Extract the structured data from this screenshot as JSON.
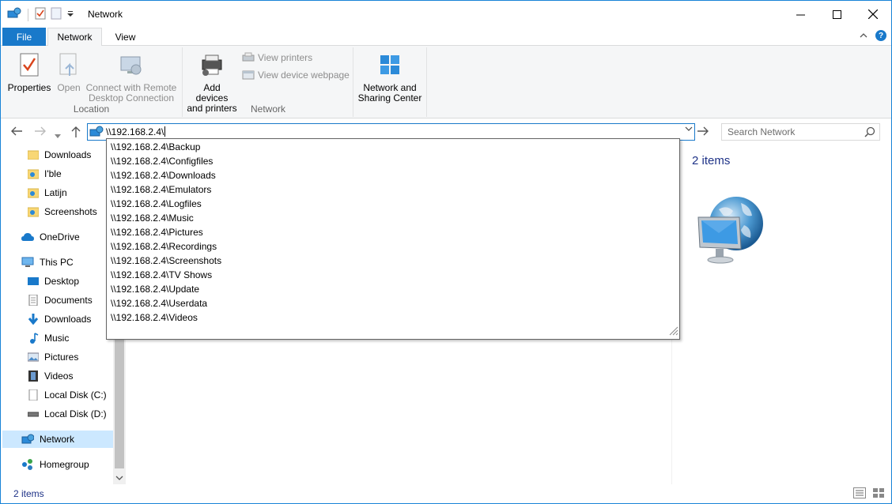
{
  "window": {
    "title": "Network",
    "controls": {
      "minimize": "—",
      "maximize": "☐",
      "close": "✕"
    }
  },
  "ribbon": {
    "tabs": [
      {
        "label": "File"
      },
      {
        "label": "Network"
      },
      {
        "label": "View"
      }
    ],
    "groups": {
      "location": {
        "label": "Location",
        "properties": "Properties",
        "open": "Open",
        "remote_line1": "Connect with Remote",
        "remote_line2": "Desktop Connection"
      },
      "network": {
        "label": "Network",
        "add_line1": "Add devices",
        "add_line2": "and printers",
        "view_printers": "View printers",
        "view_device_webpage": "View device webpage"
      },
      "sharing": {
        "line1": "Network and",
        "line2": "Sharing Center"
      }
    }
  },
  "address": {
    "value": "\\\\192.168.2.4\\"
  },
  "search": {
    "placeholder": "Search Network"
  },
  "autocomplete": [
    "\\\\192.168.2.4\\Backup",
    "\\\\192.168.2.4\\Configfiles",
    "\\\\192.168.2.4\\Downloads",
    "\\\\192.168.2.4\\Emulators",
    "\\\\192.168.2.4\\Logfiles",
    "\\\\192.168.2.4\\Music",
    "\\\\192.168.2.4\\Pictures",
    "\\\\192.168.2.4\\Recordings",
    "\\\\192.168.2.4\\Screenshots",
    "\\\\192.168.2.4\\TV Shows",
    "\\\\192.168.2.4\\Update",
    "\\\\192.168.2.4\\Userdata",
    "\\\\192.168.2.4\\Videos"
  ],
  "nav_pane": {
    "quick_access": [
      "Downloads",
      "I'ble",
      "Latijn",
      "Screenshots"
    ],
    "onedrive": "OneDrive",
    "this_pc": "This PC",
    "pc_items": [
      "Desktop",
      "Documents",
      "Downloads",
      "Music",
      "Pictures",
      "Videos",
      "Local Disk (C:)",
      "Local Disk (D:)"
    ],
    "network": "Network",
    "homegroup": "Homegroup"
  },
  "details": {
    "count": "2 items"
  },
  "status": {
    "count": "2 items"
  },
  "colors": {
    "accent": "#1979ca",
    "selection": "#cce8ff",
    "link_text": "#1e3287"
  }
}
